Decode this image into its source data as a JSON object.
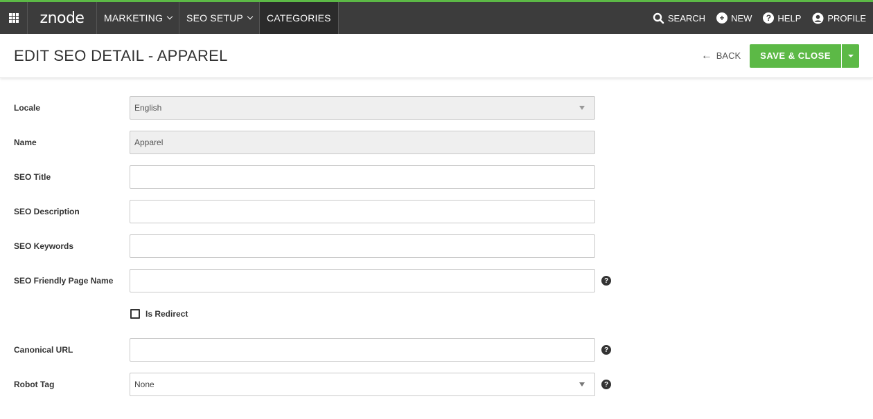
{
  "nav": {
    "logo": "znode",
    "items": [
      {
        "label": "MARKETING",
        "has_dropdown": true
      },
      {
        "label": "SEO SETUP",
        "has_dropdown": true
      },
      {
        "label": "CATEGORIES",
        "has_dropdown": false
      }
    ],
    "right": {
      "search": "SEARCH",
      "new": "NEW",
      "help": "HELP",
      "profile": "PROFILE"
    },
    "accent_color": "#5cb946",
    "bg_color": "#3c3c3c"
  },
  "header": {
    "title": "EDIT SEO DETAIL - APPAREL",
    "back_label": "BACK",
    "save_label": "SAVE & CLOSE"
  },
  "form": {
    "locale": {
      "label": "Locale",
      "value": "English"
    },
    "name": {
      "label": "Name",
      "value": "Apparel"
    },
    "seo_title": {
      "label": "SEO Title",
      "value": ""
    },
    "seo_description": {
      "label": "SEO Description",
      "value": ""
    },
    "seo_keywords": {
      "label": "SEO Keywords",
      "value": ""
    },
    "seo_friendly_page_name": {
      "label": "SEO Friendly Page Name",
      "value": ""
    },
    "is_redirect": {
      "label": "Is Redirect",
      "checked": false
    },
    "canonical_url": {
      "label": "Canonical URL",
      "value": ""
    },
    "robot_tag": {
      "label": "Robot Tag",
      "value": "None"
    }
  },
  "icons": {
    "apps": "apps-grid-icon",
    "search": "search-icon",
    "new": "plus-circle-icon",
    "help": "question-circle-icon",
    "profile": "user-circle-icon"
  }
}
